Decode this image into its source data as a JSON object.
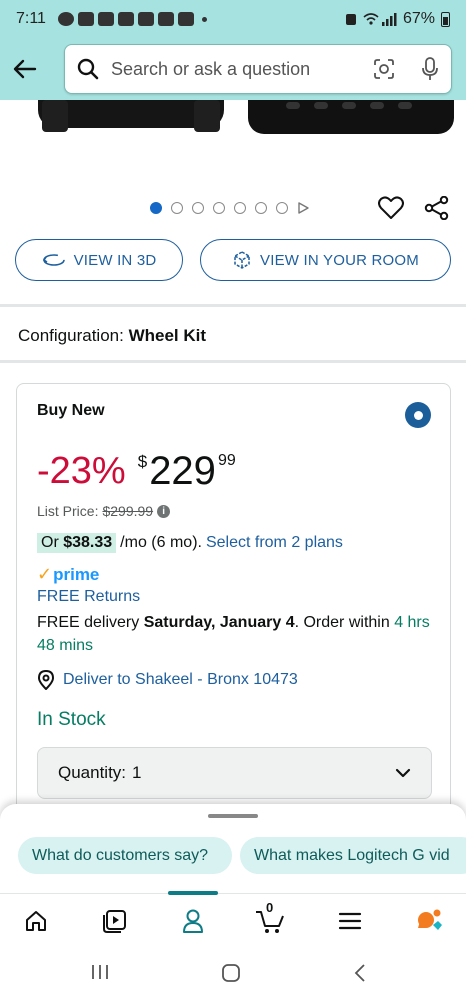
{
  "status_bar": {
    "time": "7:11",
    "battery_percent": "67%"
  },
  "search": {
    "placeholder": "Search or ask a question"
  },
  "carousel": {
    "dot_count": 7,
    "active_index": 0
  },
  "buttons": {
    "view_3d": "VIEW IN 3D",
    "view_room": "VIEW IN YOUR ROOM"
  },
  "configuration": {
    "label": "Configuration:",
    "value": "Wheel Kit"
  },
  "buy_box": {
    "title": "Buy New",
    "discount": "-23%",
    "currency": "$",
    "price_whole": "229",
    "price_fraction": "99",
    "list_price_label": "List Price:",
    "list_price_value": "$299.99",
    "monthly_prefix": "Or",
    "monthly_amount": "$38.33",
    "monthly_suffix": "/mo (6 mo).",
    "plans_link": "Select from 2 plans",
    "prime": "prime",
    "free_returns": "FREE Returns",
    "delivery_prefix": "FREE delivery",
    "delivery_date": "Saturday, January 4",
    "delivery_suffix": ". Order within",
    "order_within": "4 hrs 48 mins",
    "deliver_to": "Deliver to Shakeel - Bronx 10473",
    "stock": "In Stock",
    "quantity_label": "Quantity:",
    "quantity_value": "1"
  },
  "suggestions": [
    "What do customers say?",
    "What makes Logitech G vid"
  ],
  "nav": {
    "cart_count": "0",
    "active": "account"
  },
  "colors": {
    "header_bg": "#a6e3e0",
    "link": "#1e5f9e",
    "discount": "#cc0c39",
    "in_stock": "#067d62",
    "prime": "#1a98ff"
  }
}
